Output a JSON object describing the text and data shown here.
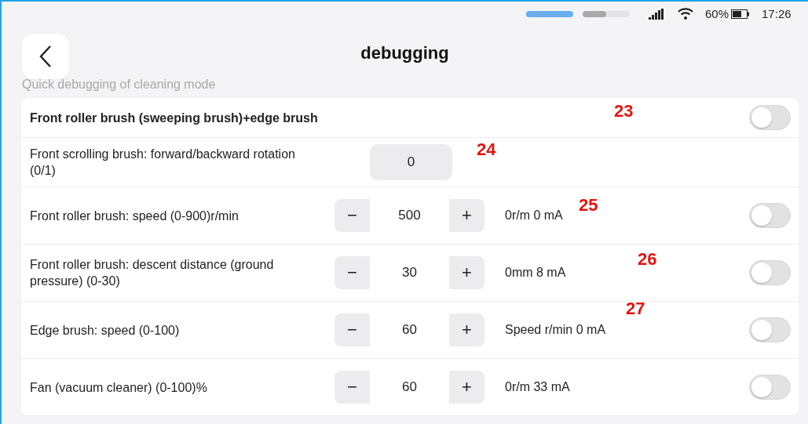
{
  "status_bar": {
    "battery_text": "60%",
    "time": "17:26"
  },
  "header": {
    "title": "debugging"
  },
  "section_label": "Quick debugging of cleaning mode",
  "rows": [
    {
      "kind": "heading",
      "label": "Front roller brush (sweeping brush)+edge brush",
      "on": false,
      "annotation": "23"
    },
    {
      "kind": "input",
      "label": "Front scrolling brush: forward/backward rotation (0/1)",
      "value": "0",
      "annotation": "24"
    },
    {
      "kind": "stepper",
      "label": "Front roller brush: speed (0-900)r/min",
      "minus": "−",
      "value": "500",
      "plus": "+",
      "reading": "0r/m 0 mA",
      "on": false,
      "annotation": "25"
    },
    {
      "kind": "stepper",
      "label": "Front roller brush: descent distance (ground pressure) (0-30)",
      "minus": "−",
      "value": "30",
      "plus": "+",
      "reading": "0mm 8 mA",
      "on": false,
      "annotation": "26"
    },
    {
      "kind": "stepper",
      "label": "Edge brush: speed (0-100)",
      "minus": "−",
      "value": "60",
      "plus": "+",
      "reading": "Speed r/min 0 mA",
      "on": false,
      "annotation": "27"
    },
    {
      "kind": "stepper",
      "label": "Fan (vacuum cleaner) (0-100)%",
      "minus": "−",
      "value": "60",
      "plus": "+",
      "reading": "0r/m 33 mA",
      "on": false
    }
  ]
}
